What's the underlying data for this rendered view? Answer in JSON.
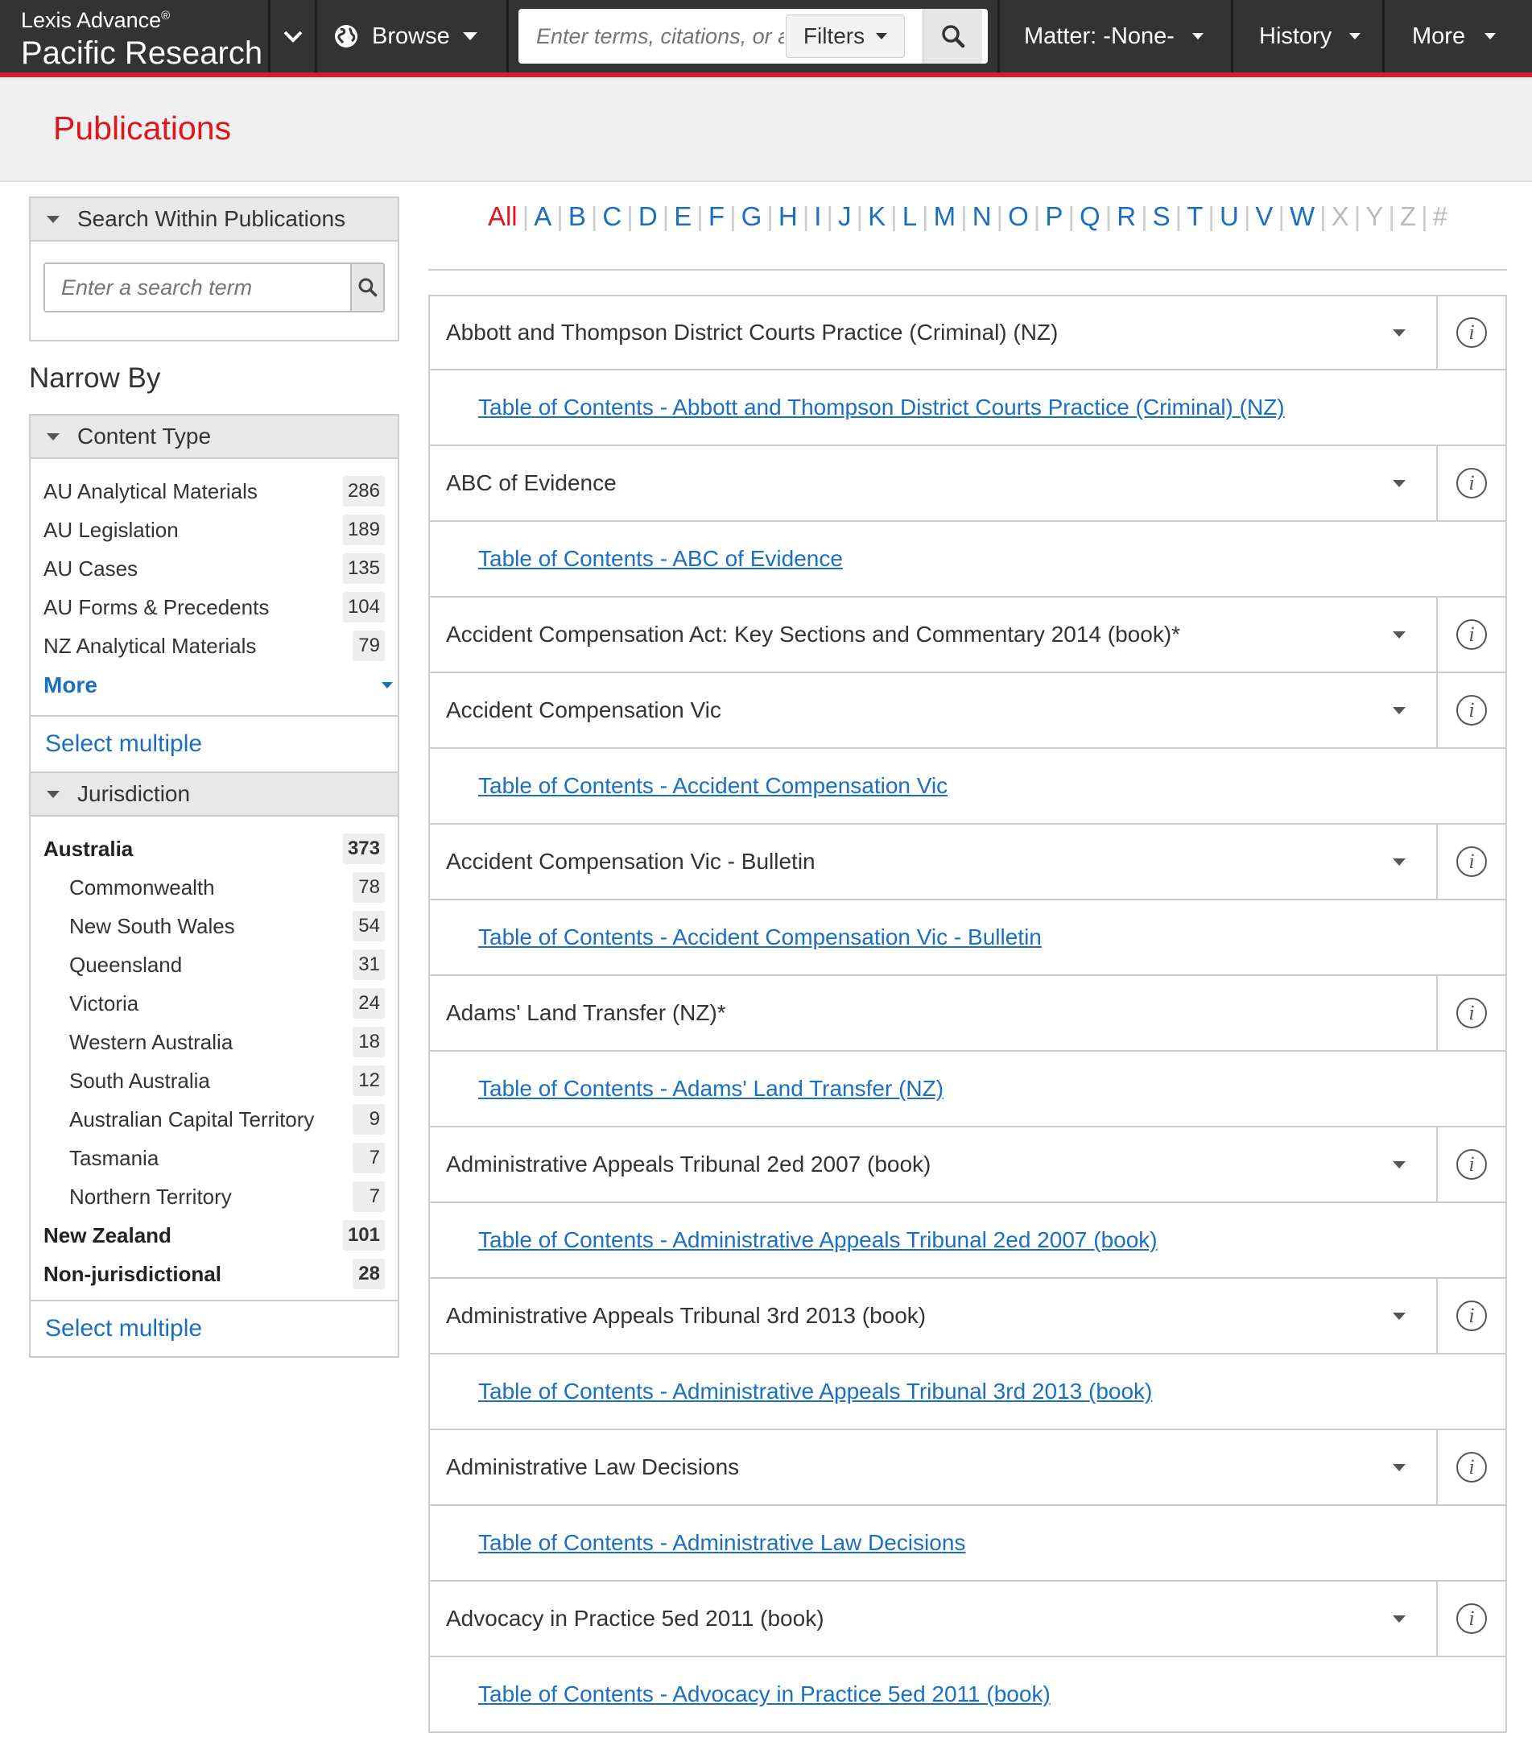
{
  "header": {
    "brand_top": "Lexis Advance",
    "brand_reg": "®",
    "brand_bottom": "Pacific Research",
    "browse_label": "Browse",
    "search_placeholder": "Enter terms, citations, or a",
    "filters_label": "Filters",
    "matter_label": "Matter: -None-",
    "history_label": "History",
    "more_label": "More"
  },
  "page": {
    "title": "Publications"
  },
  "sidebar": {
    "search_within_title": "Search Within Publications",
    "search_within_placeholder": "Enter a search term",
    "narrow_by": "Narrow By",
    "content_type": {
      "title": "Content Type",
      "items": [
        {
          "label": "AU Analytical Materials",
          "count": "286"
        },
        {
          "label": "AU Legislation",
          "count": "189"
        },
        {
          "label": "AU Cases",
          "count": "135"
        },
        {
          "label": "AU Forms & Precedents",
          "count": "104"
        },
        {
          "label": "NZ Analytical Materials",
          "count": "79"
        }
      ],
      "more_label": "More",
      "select_multiple": "Select multiple"
    },
    "jurisdiction": {
      "title": "Jurisdiction",
      "items": [
        {
          "label": "Australia",
          "count": "373"
        },
        {
          "label": "Commonwealth",
          "count": "78"
        },
        {
          "label": "New South Wales",
          "count": "54"
        },
        {
          "label": "Queensland",
          "count": "31"
        },
        {
          "label": "Victoria",
          "count": "24"
        },
        {
          "label": "Western Australia",
          "count": "18"
        },
        {
          "label": "South Australia",
          "count": "12"
        },
        {
          "label": "Australian Capital Territory",
          "count": "9"
        },
        {
          "label": "Tasmania",
          "count": "7"
        },
        {
          "label": "Northern Territory",
          "count": "7"
        },
        {
          "label": "New Zealand",
          "count": "101"
        },
        {
          "label": "Non-jurisdictional",
          "count": "28"
        }
      ],
      "select_multiple": "Select multiple"
    }
  },
  "alphabet": [
    "All",
    "A",
    "B",
    "C",
    "D",
    "E",
    "F",
    "G",
    "H",
    "I",
    "J",
    "K",
    "L",
    "M",
    "N",
    "O",
    "P",
    "Q",
    "R",
    "S",
    "T",
    "U",
    "V",
    "W",
    "X",
    "Y",
    "Z",
    "#"
  ],
  "publications": [
    {
      "title": "Abbott and Thompson District Courts Practice (Criminal) (NZ)",
      "toc": "Table of Contents - Abbott and Thompson District Courts Practice (Criminal) (NZ)"
    },
    {
      "title": "ABC of Evidence",
      "toc": "Table of Contents - ABC of Evidence"
    },
    {
      "title": "Accident Compensation Act: Key Sections and Commentary 2014 (book)*"
    },
    {
      "title": "Accident Compensation Vic",
      "toc": "Table of Contents - Accident Compensation Vic"
    },
    {
      "title": "Accident Compensation Vic - Bulletin",
      "toc": "Table of Contents - Accident Compensation Vic - Bulletin"
    },
    {
      "title": "Adams' Land Transfer (NZ)*",
      "toc": "Table of Contents - Adams' Land Transfer (NZ)"
    },
    {
      "title": "Administrative Appeals Tribunal 2ed 2007 (book)",
      "toc": "Table of Contents - Administrative Appeals Tribunal 2ed 2007 (book)"
    },
    {
      "title": "Administrative Appeals Tribunal 3rd 2013 (book)",
      "toc": "Table of Contents - Administrative Appeals Tribunal 3rd 2013 (book)"
    },
    {
      "title": "Administrative Law Decisions",
      "toc": "Table of Contents - Administrative Law Decisions"
    },
    {
      "title": "Advocacy in Practice 5ed 2011 (book)",
      "toc": "Table of Contents - Advocacy in Practice 5ed 2011 (book)"
    }
  ],
  "colors": {
    "brand_red": "#e2141c",
    "link_blue": "#1a6fc4",
    "nav_bg": "#333333"
  }
}
